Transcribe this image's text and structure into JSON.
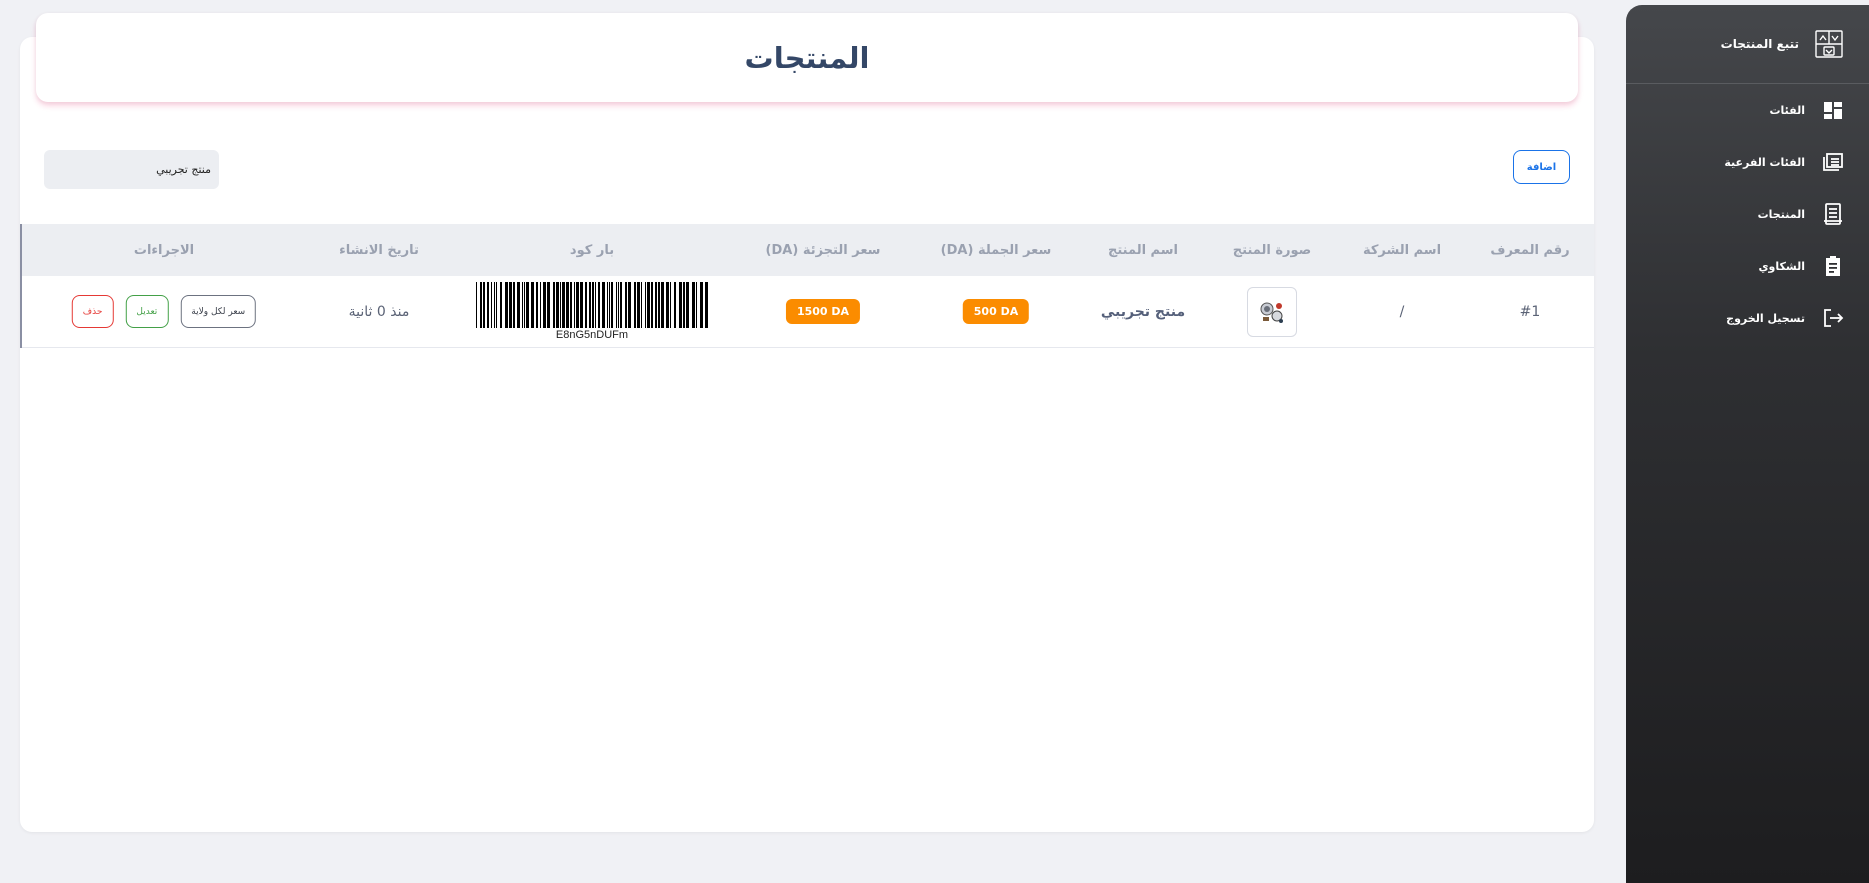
{
  "app": {
    "brand_label": "تتبع المنتجات"
  },
  "sidebar": {
    "items": [
      {
        "label": "الفئات",
        "icon": "dashboard-icon"
      },
      {
        "label": "الفئات الفرعية",
        "icon": "subcategories-icon"
      },
      {
        "label": "المنتجات",
        "icon": "receipt-icon"
      },
      {
        "label": "الشكاوي",
        "icon": "clipboard-icon"
      },
      {
        "label": "تسجيل الخروج",
        "icon": "logout-icon"
      }
    ]
  },
  "page": {
    "title": "المنتجات",
    "add_label": "اضافة",
    "search_value": "منتج تجريبي"
  },
  "table": {
    "headers": {
      "id": "رقم المعرف",
      "company": "اسم الشركة",
      "image": "صورة المنتج",
      "name": "اسم المنتج",
      "wholesale": "سعر الجملة (DA)",
      "retail": "سعر التجزئة (DA)",
      "barcode": "بار كود",
      "created": "تاريخ الانشاء",
      "actions": "الاجراءات"
    },
    "rows": [
      {
        "id": "#1",
        "company": "/",
        "name": "منتج تجريبي",
        "wholesale": "500 DA",
        "retail": "1500 DA",
        "barcode_text": "E8nG5nDUFm",
        "created": "منذ 0 ثانية",
        "btn_region": "سعر لكل ولاية",
        "btn_edit": "تعديل",
        "btn_delete": "حذف"
      }
    ]
  },
  "colors": {
    "accent": "#1a73e8",
    "badge": "#fb8c00",
    "edit": "#43a047",
    "delete": "#e53935"
  }
}
